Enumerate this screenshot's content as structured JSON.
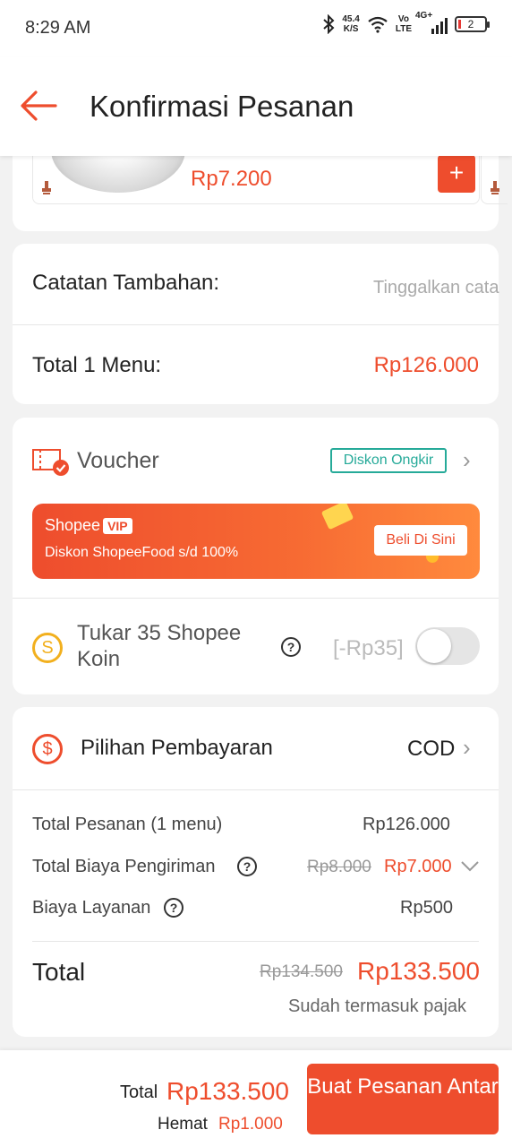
{
  "status_bar": {
    "time": "8:29 AM",
    "speed_value": "45.4",
    "speed_unit": "K/S",
    "volte_top": "Vo",
    "volte_bottom": "LTE",
    "network": "4G+",
    "battery": "2"
  },
  "header": {
    "title": "Konfirmasi Pesanan"
  },
  "item": {
    "price": "Rp7.200",
    "add_label": "+"
  },
  "notes": {
    "label": "Catatan Tambahan:",
    "placeholder": "Tinggalkan cata"
  },
  "menu_total": {
    "label": "Total 1 Menu:",
    "value": "Rp126.000"
  },
  "voucher": {
    "label": "Voucher",
    "tag": "Diskon Ongkir"
  },
  "vip_banner": {
    "brand": "Shopee",
    "badge": "VIP",
    "text": "Diskon ShopeeFood s/d 100%",
    "button": "Beli Di Sini"
  },
  "coins": {
    "label": "Tukar 35 Shopee Koin",
    "value": "[-Rp35]",
    "enabled": false
  },
  "payment": {
    "label": "Pilihan Pembayaran",
    "method": "COD"
  },
  "summary": {
    "order_label": "Total Pesanan (1 menu)",
    "order_value": "Rp126.000",
    "shipping_label": "Total Biaya Pengiriman",
    "shipping_old": "Rp8.000",
    "shipping_new": "Rp7.000",
    "service_label": "Biaya Layanan",
    "service_value": "Rp500",
    "total_label": "Total",
    "total_old": "Rp134.500",
    "total_new": "Rp133.500",
    "tax_note": "Sudah termasuk pajak"
  },
  "bottom_bar": {
    "total_label": "Total",
    "total_value": "Rp133.500",
    "save_label": "Hemat",
    "save_value": "Rp1.000",
    "order_button": "Buat Pesanan Antar"
  },
  "colors": {
    "accent": "#ee4d2d",
    "teal": "#26aa99",
    "coin": "#f2b01e"
  }
}
